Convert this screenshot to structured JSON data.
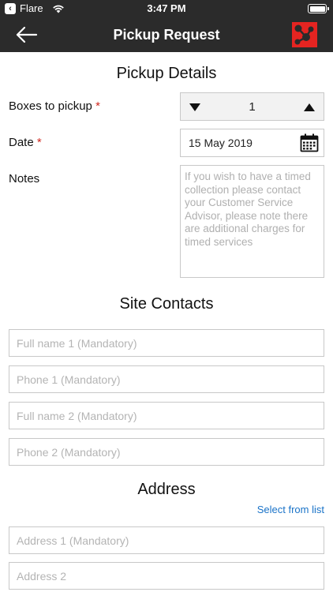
{
  "status_bar": {
    "back_app": "Flare",
    "time": "3:47 PM"
  },
  "nav": {
    "title": "Pickup Request"
  },
  "pickup_details": {
    "heading": "Pickup Details",
    "boxes_label": "Boxes to pickup",
    "boxes_value": "1",
    "date_label": "Date",
    "date_value": "15 May 2019",
    "notes_label": "Notes",
    "notes_placeholder": "If you wish to have a timed collection please contact your Customer Service Advisor, please note there are additional charges for timed services",
    "required_marker": "*"
  },
  "site_contacts": {
    "heading": "Site Contacts",
    "fullname1_placeholder": "Full name 1 (Mandatory)",
    "phone1_placeholder": "Phone 1 (Mandatory)",
    "fullname2_placeholder": "Full name 2 (Mandatory)",
    "phone2_placeholder": "Phone 2 (Mandatory)"
  },
  "address": {
    "heading": "Address",
    "select_link": "Select from list",
    "address1_placeholder": "Address 1 (Mandatory)",
    "address2_placeholder": "Address 2"
  },
  "colors": {
    "bar_background": "#2b2b2b",
    "required": "#d0271f",
    "link": "#1a73c8",
    "logo": "#e52421"
  }
}
